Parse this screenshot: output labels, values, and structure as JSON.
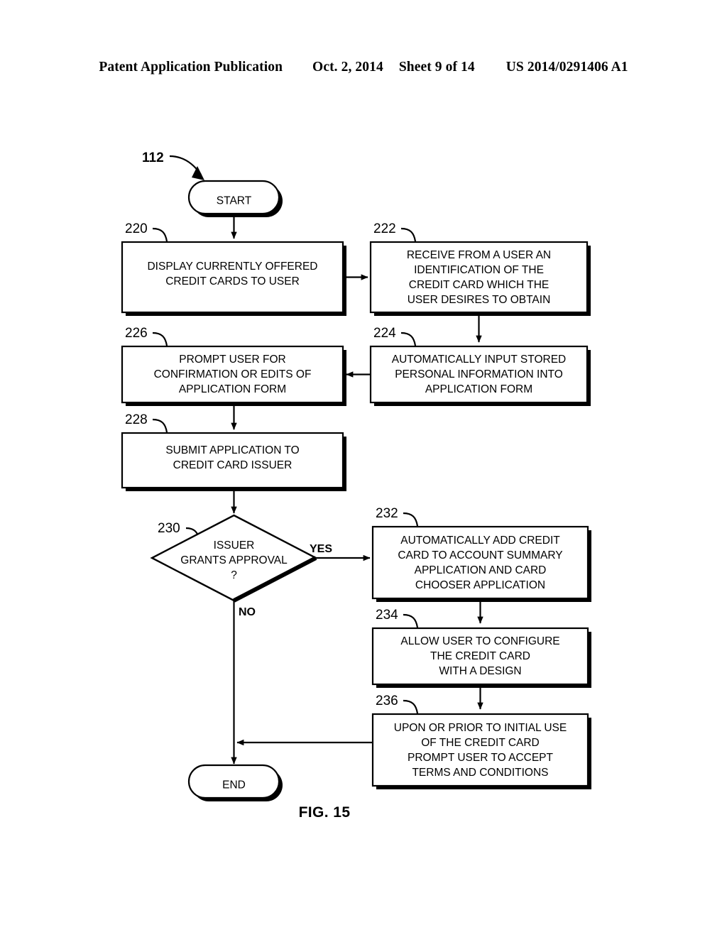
{
  "header": {
    "publication": "Patent Application Publication",
    "date": "Oct. 2, 2014",
    "sheet": "Sheet 9 of 14",
    "patent_number": "US 2014/0291406 A1"
  },
  "figure": {
    "caption": "FIG. 15",
    "diagram_ref": "112",
    "line_color": "#000000",
    "fill_color": "#ffffff"
  },
  "flowchart": {
    "type": "flowchart",
    "terminals": [
      {
        "id": "start",
        "label": "START"
      },
      {
        "id": "end",
        "label": "END"
      }
    ],
    "steps": [
      {
        "ref": "220",
        "lines": [
          "DISPLAY CURRENTLY OFFERED",
          "CREDIT CARDS TO USER"
        ]
      },
      {
        "ref": "222",
        "lines": [
          "RECEIVE FROM A USER AN",
          "IDENTIFICATION OF THE",
          "CREDIT CARD WHICH THE",
          "USER DESIRES TO OBTAIN"
        ]
      },
      {
        "ref": "224",
        "lines": [
          "AUTOMATICALLY INPUT STORED",
          "PERSONAL INFORMATION INTO",
          "APPLICATION FORM"
        ]
      },
      {
        "ref": "226",
        "lines": [
          "PROMPT USER FOR",
          "CONFIRMATION OR EDITS OF",
          "APPLICATION FORM"
        ]
      },
      {
        "ref": "228",
        "lines": [
          "SUBMIT APPLICATION TO",
          "CREDIT CARD ISSUER"
        ]
      },
      {
        "ref": "232",
        "lines": [
          "AUTOMATICALLY ADD CREDIT",
          "CARD TO ACCOUNT SUMMARY",
          "APPLICATION AND CARD",
          "CHOOSER APPLICATION"
        ]
      },
      {
        "ref": "234",
        "lines": [
          "ALLOW USER TO CONFIGURE",
          "THE CREDIT CARD",
          "WITH A DESIGN"
        ]
      },
      {
        "ref": "236",
        "lines": [
          "UPON OR PRIOR TO INITIAL USE",
          "OF THE CREDIT CARD",
          "PROMPT USER TO ACCEPT",
          "TERMS AND CONDITIONS"
        ]
      }
    ],
    "decision": {
      "ref": "230",
      "lines": [
        "ISSUER",
        "GRANTS APPROVAL",
        "?"
      ],
      "branches": [
        {
          "id": "yes",
          "label": "YES"
        },
        {
          "id": "no",
          "label": "NO"
        }
      ]
    }
  }
}
